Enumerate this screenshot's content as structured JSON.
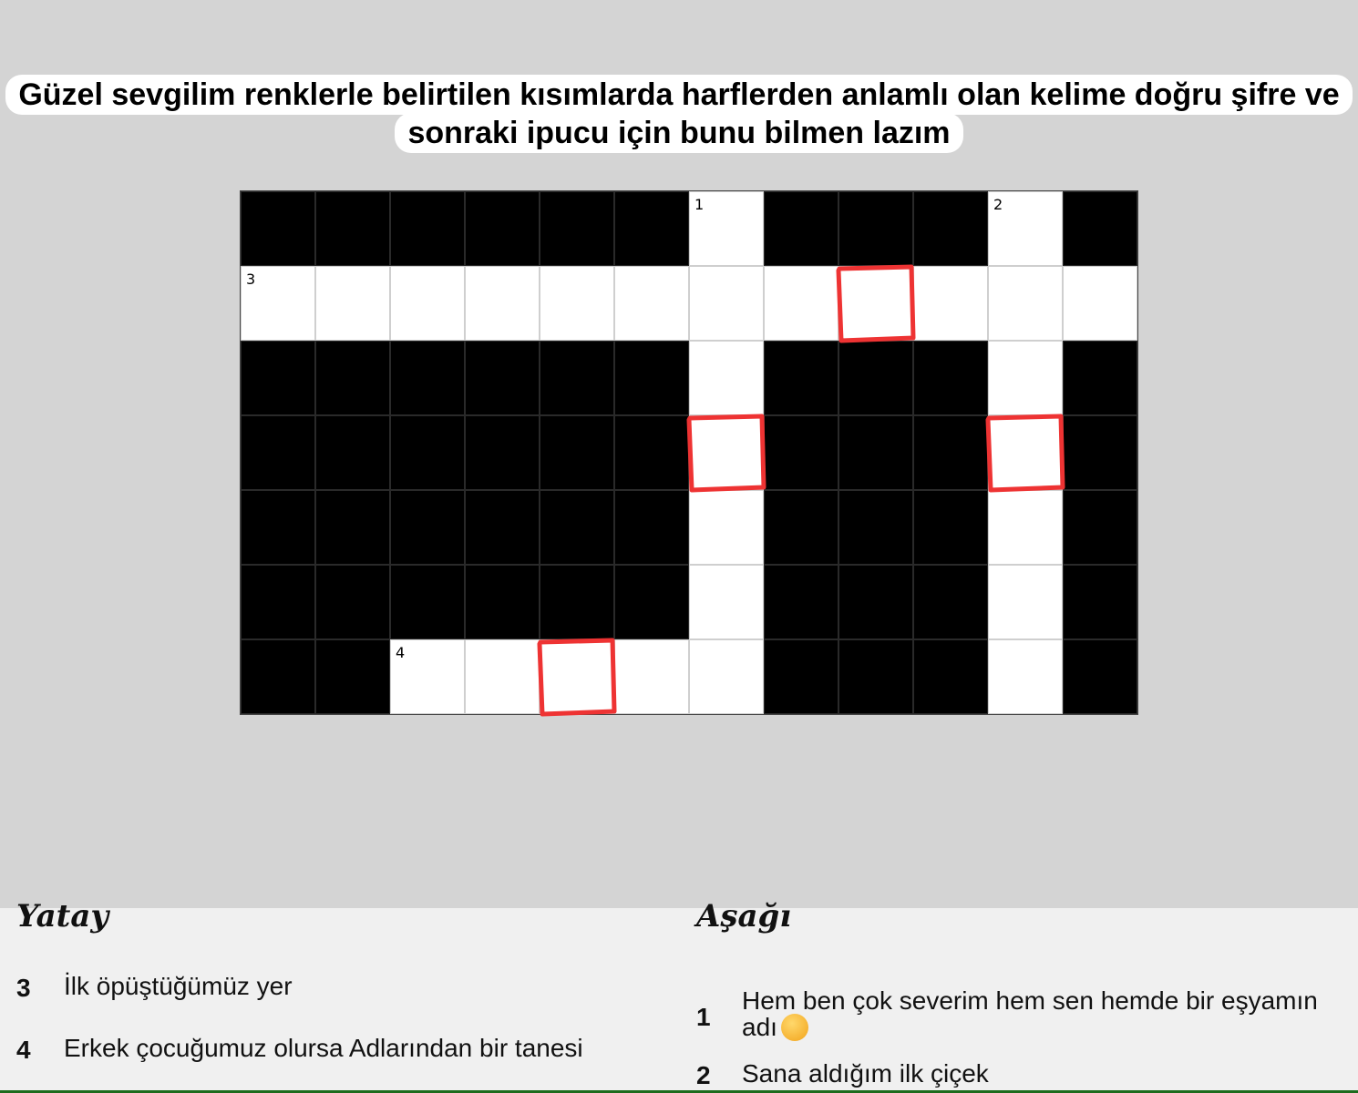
{
  "title": {
    "line1": "Güzel sevgilim renklerle belirtilen kısımlarda harflerden anlamlı olan kelime doğru şifre ve",
    "line2": "sonraki ipucu için bunu bilmen lazım"
  },
  "puzzle": {
    "rows": 7,
    "cols": 12,
    "layout": [
      "######1###2#",
      "3...........",
      "######.###.#",
      "######.###.#",
      "######.###.#",
      "######.###.#",
      "##4....###.#"
    ],
    "numbers": [
      {
        "row": 0,
        "col": 6,
        "label": "1"
      },
      {
        "row": 0,
        "col": 10,
        "label": "2"
      },
      {
        "row": 1,
        "col": 0,
        "label": "3"
      },
      {
        "row": 6,
        "col": 2,
        "label": "4"
      }
    ],
    "highlighted_cells": [
      {
        "row": 1,
        "col": 8
      },
      {
        "row": 3,
        "col": 6
      },
      {
        "row": 3,
        "col": 10
      },
      {
        "row": 6,
        "col": 4
      }
    ],
    "highlight_color": "#ee3333"
  },
  "clues": {
    "across_heading": "Yatay",
    "down_heading": "Aşağı",
    "across": [
      {
        "number": "3",
        "text": "İlk öpüştüğümüz yer"
      },
      {
        "number": "4",
        "text": "Erkek çocuğumuz olursa Adlarından bir tanesi"
      }
    ],
    "down": [
      {
        "number": "1",
        "text_line1": "Hem ben çok severim hem sen hemde bir eşyamın",
        "text_line2": "adı",
        "icon": "shushing-face-emoji"
      },
      {
        "number": "2",
        "text": "Sana aldığım ilk çiçek"
      }
    ]
  }
}
